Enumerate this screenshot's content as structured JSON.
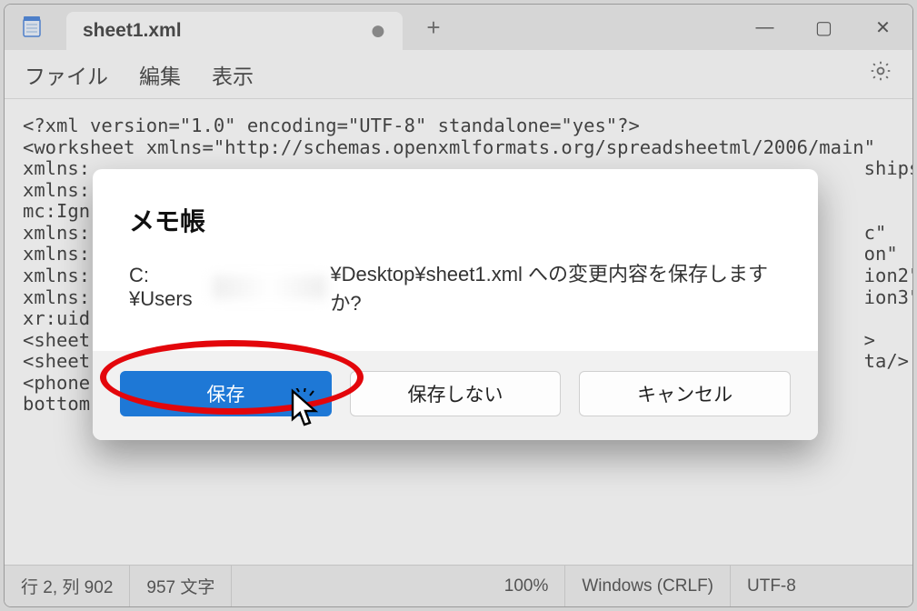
{
  "window": {
    "tabTitle": "sheet1.xml",
    "tabDirty": "●",
    "newTabSymbol": "+",
    "controls": {
      "minimize": "—",
      "maximize": "▢",
      "close": "✕"
    }
  },
  "menu": {
    "file": "ファイル",
    "edit": "編集",
    "view": "表示"
  },
  "editor": {
    "lines": [
      "<?xml version=\"1.0\" encoding=\"UTF-8\" standalone=\"yes\"?>",
      "<worksheet xmlns=\"http://schemas.openxmlformats.org/spreadsheetml/2006/main\"",
      "xmlns:                                                                     ships\"",
      "xmlns:",
      "mc:Ign",
      "xmlns:                                                                     c\"",
      "xmlns:                                                                     on\"",
      "xmlns:                                                                     ion2\"",
      "xmlns:                                                                     ion3\"",
      "xr:uid",
      "<sheet                                                                     >",
      "<sheet                                                                     ta/>",
      "<phone",
      "bottom"
    ]
  },
  "status": {
    "pos": "行 2, 列 902",
    "chars": "957 文字",
    "zoom": "100%",
    "lineEnding": "Windows (CRLF)",
    "encoding": "UTF-8"
  },
  "dialog": {
    "title": "メモ帳",
    "messagePrefix": "C:¥Users",
    "messageSuffix": "¥Desktop¥sheet1.xml への変更内容を保存しますか?",
    "save": "保存",
    "dontSave": "保存しない",
    "cancel": "キャンセル"
  }
}
